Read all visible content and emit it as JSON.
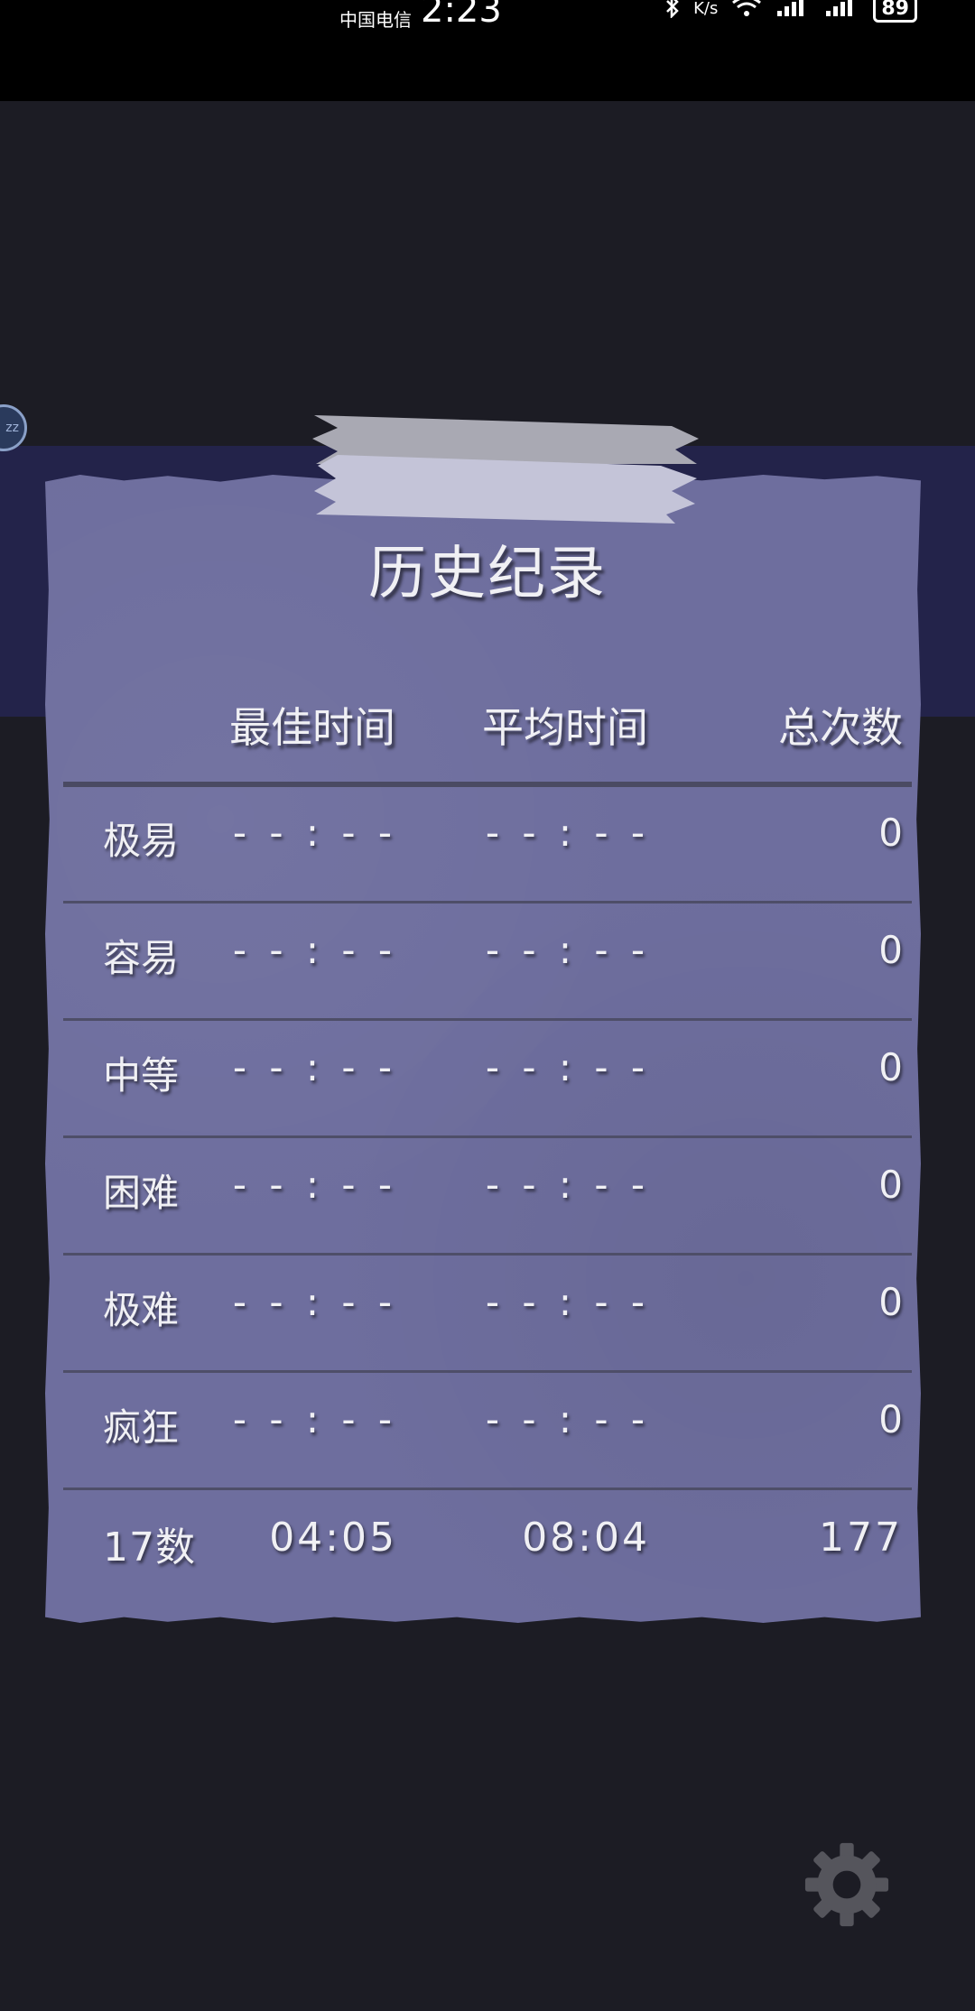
{
  "status_bar": {
    "carrier": "中国电信",
    "time": "2:23",
    "netspeed_unit": "K/s",
    "battery": "89",
    "icons": [
      "bluetooth-icon",
      "wifi-icon",
      "signal-icon",
      "signal-icon",
      "battery-icon"
    ]
  },
  "side_badge": "zz",
  "panel": {
    "title": "历史纪录",
    "headers": {
      "best": "最佳时间",
      "avg": "平均时间",
      "total": "总次数"
    },
    "rows": [
      {
        "level": "极易",
        "best": "- - : - -",
        "avg": "- - : - -",
        "total": "0"
      },
      {
        "level": "容易",
        "best": "- - : - -",
        "avg": "- - : - -",
        "total": "0"
      },
      {
        "level": "中等",
        "best": "- - : - -",
        "avg": "- - : - -",
        "total": "0"
      },
      {
        "level": "困难",
        "best": "- - : - -",
        "avg": "- - : - -",
        "total": "0"
      },
      {
        "level": "极难",
        "best": "- - : - -",
        "avg": "- - : - -",
        "total": "0"
      },
      {
        "level": "疯狂",
        "best": "- - : - -",
        "avg": "- - : - -",
        "total": "0"
      }
    ],
    "summary": {
      "level": "17数",
      "best": "04:05",
      "avg": "08:04",
      "total": "177"
    }
  },
  "settings_icon": "gear-icon",
  "colors": {
    "background": "#1c1c24",
    "band": "#23234a",
    "paper": "#6e6e9e",
    "divider": "#4e4e68",
    "tape_dark": "#a9a9b3",
    "tape_light": "#c4c4d8",
    "gear": "#55555c"
  }
}
